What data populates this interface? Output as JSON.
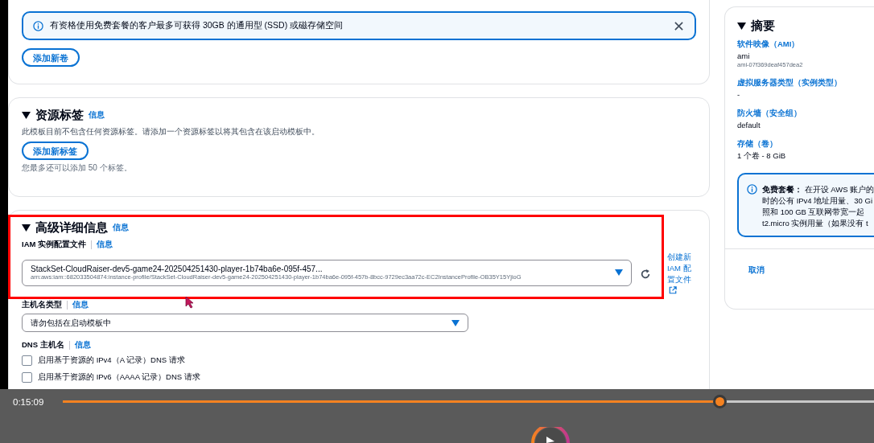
{
  "storage_card": {
    "alert": {
      "text": "有资格使用免费套餐的客户最多可获得 30GB 的通用型 (SSD) 或磁存储空间"
    },
    "add_button": "添加新卷"
  },
  "tags_card": {
    "title": "资源标签",
    "info": "信息",
    "expanded": true,
    "description": "此模板目前不包含任何资源标签。请添加一个资源标签以将其包含在该启动模板中。",
    "add_button": "添加新标签",
    "hint": "您最多还可以添加 50 个标签。"
  },
  "advanced_card": {
    "title": "高级详细信息",
    "info": "信息",
    "expanded": true,
    "fields": [
      {
        "kind": "select",
        "label": "IAM 实例配置文件",
        "info": "信息",
        "value": "StackSet-CloudRaiser-dev5-game24-202504251430-player-1b74ba6e-095f-457...",
        "secondary": "arn:aws:iam::682033504874:instance-profile/StackSet-CloudRaiser-dev5-game24-202504251430-player-1b74ba6e-095f-457b-8bcc-9729ec3aa72c-EC2InstanceProfile-OB35Y15YjioG",
        "link": "创建新 IAM 配置文件"
      },
      {
        "kind": "select",
        "label": "主机名类型",
        "info": "信息",
        "value": "请勿包括在启动模板中"
      },
      {
        "kind": "checkboxes",
        "label": "DNS 主机名",
        "info": "信息",
        "options": [
          {
            "label": "启用基于资源的 IPv4（A 记录）DNS 请求",
            "checked": false
          },
          {
            "label": "启用基于资源的 IPv6（AAAA 记录）DNS 请求",
            "checked": false
          }
        ]
      }
    ]
  },
  "summary": {
    "title": "摘要",
    "expanded": true,
    "items": [
      {
        "label": "软件映像（AMI）",
        "value": "ami",
        "detail": "ami-07f369deaf457dea2"
      },
      {
        "label": "虚拟服务器类型（实例类型）",
        "value": "-"
      },
      {
        "label": "防火墙（安全组）",
        "value": "default"
      },
      {
        "label": "存储（卷）",
        "value": "1 个卷 - 8 GiB"
      }
    ],
    "alert_lines": [
      "**免费套餐：** 在开设 AWS 账户的",
      "时的公有 IPv4 地址用量、30 Gi",
      "照和 100 GB 互联网带宽一起",
      "t2.micro 实例用量（如果没有 t"
    ],
    "cancel": "取消"
  },
  "video_player": {
    "time": "0:15:09",
    "level": 0.81
  }
}
